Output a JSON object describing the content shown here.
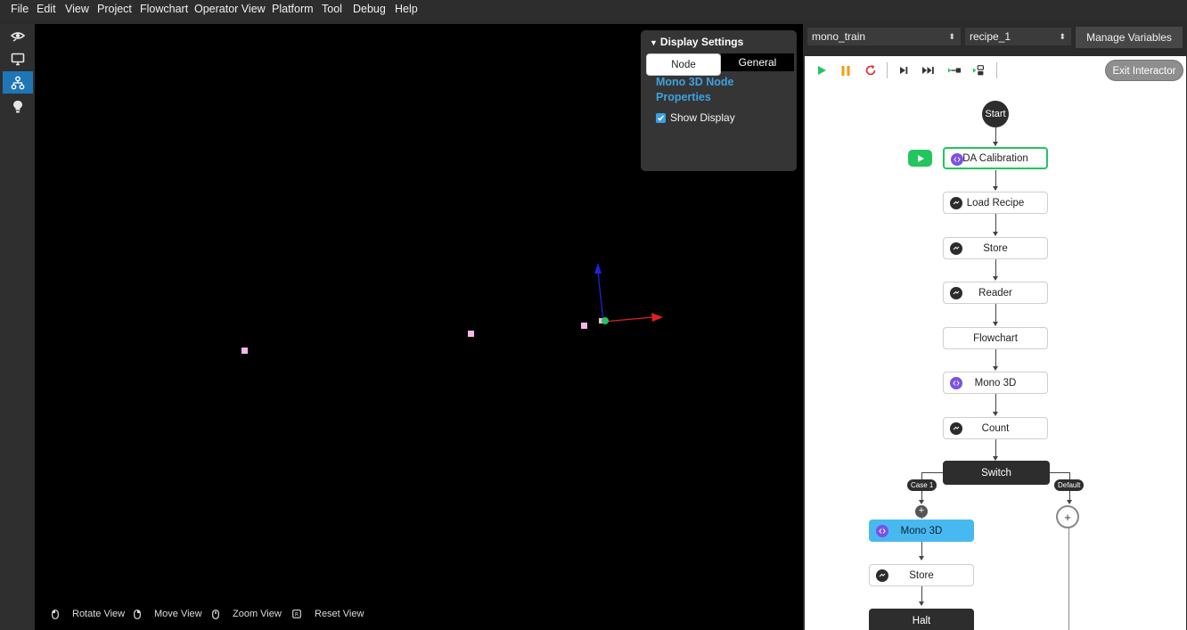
{
  "menu": [
    "File",
    "Edit",
    "View",
    "Project",
    "Flowchart",
    "Operator View",
    "Platform",
    "Tool",
    "Debug",
    "Help"
  ],
  "left_toolbar": [
    {
      "icon": "eye-icon",
      "active": false
    },
    {
      "icon": "monitor-icon",
      "active": false
    },
    {
      "icon": "flowchart-icon",
      "active": true
    },
    {
      "icon": "lightbulb-icon",
      "active": false
    }
  ],
  "display_settings": {
    "title": "Display Settings",
    "tabs": [
      "Node",
      "General"
    ],
    "active_tab": "General",
    "heading": "Mono 3D Node Properties",
    "show_display_label": "Show Display",
    "show_display_checked": true
  },
  "viewport_hints": [
    {
      "icon": "mouse-left-icon",
      "label": "Rotate View"
    },
    {
      "icon": "mouse-right-icon",
      "label": "Move View"
    },
    {
      "icon": "mouse-scroll-icon",
      "label": "Zoom View"
    },
    {
      "icon": "reset-key-icon",
      "label": "Reset View"
    }
  ],
  "right_panel": {
    "project_select": "mono_train",
    "recipe_select": "recipe_1",
    "manage_variables": "Manage Variables",
    "exit_interactor": "Exit Interactor"
  },
  "flowchart": {
    "start": "Start",
    "nodes": [
      {
        "label": "DA Calibration",
        "icon": "purple"
      },
      {
        "label": "Load Recipe",
        "icon": "dark"
      },
      {
        "label": "Store",
        "icon": "dark"
      },
      {
        "label": "Reader",
        "icon": "dark"
      },
      {
        "label": "Flowchart",
        "icon": "none"
      },
      {
        "label": "Mono 3D",
        "icon": "purple"
      },
      {
        "label": "Count",
        "icon": "dark"
      }
    ],
    "switch": "Switch",
    "case_label": "Case 1",
    "default_label": "Default",
    "case_nodes": [
      {
        "label": "Mono 3D",
        "icon": "purple"
      },
      {
        "label": "Store",
        "icon": "dark"
      }
    ],
    "halt": "Halt",
    "plus": "+"
  },
  "colors": {
    "accent_blue": "#1e77b4",
    "link_blue": "#3ba2e0",
    "running_green": "#22c55e",
    "selected_node_blue": "#48b9f0",
    "purple_node_icon": "#7b52e6"
  }
}
